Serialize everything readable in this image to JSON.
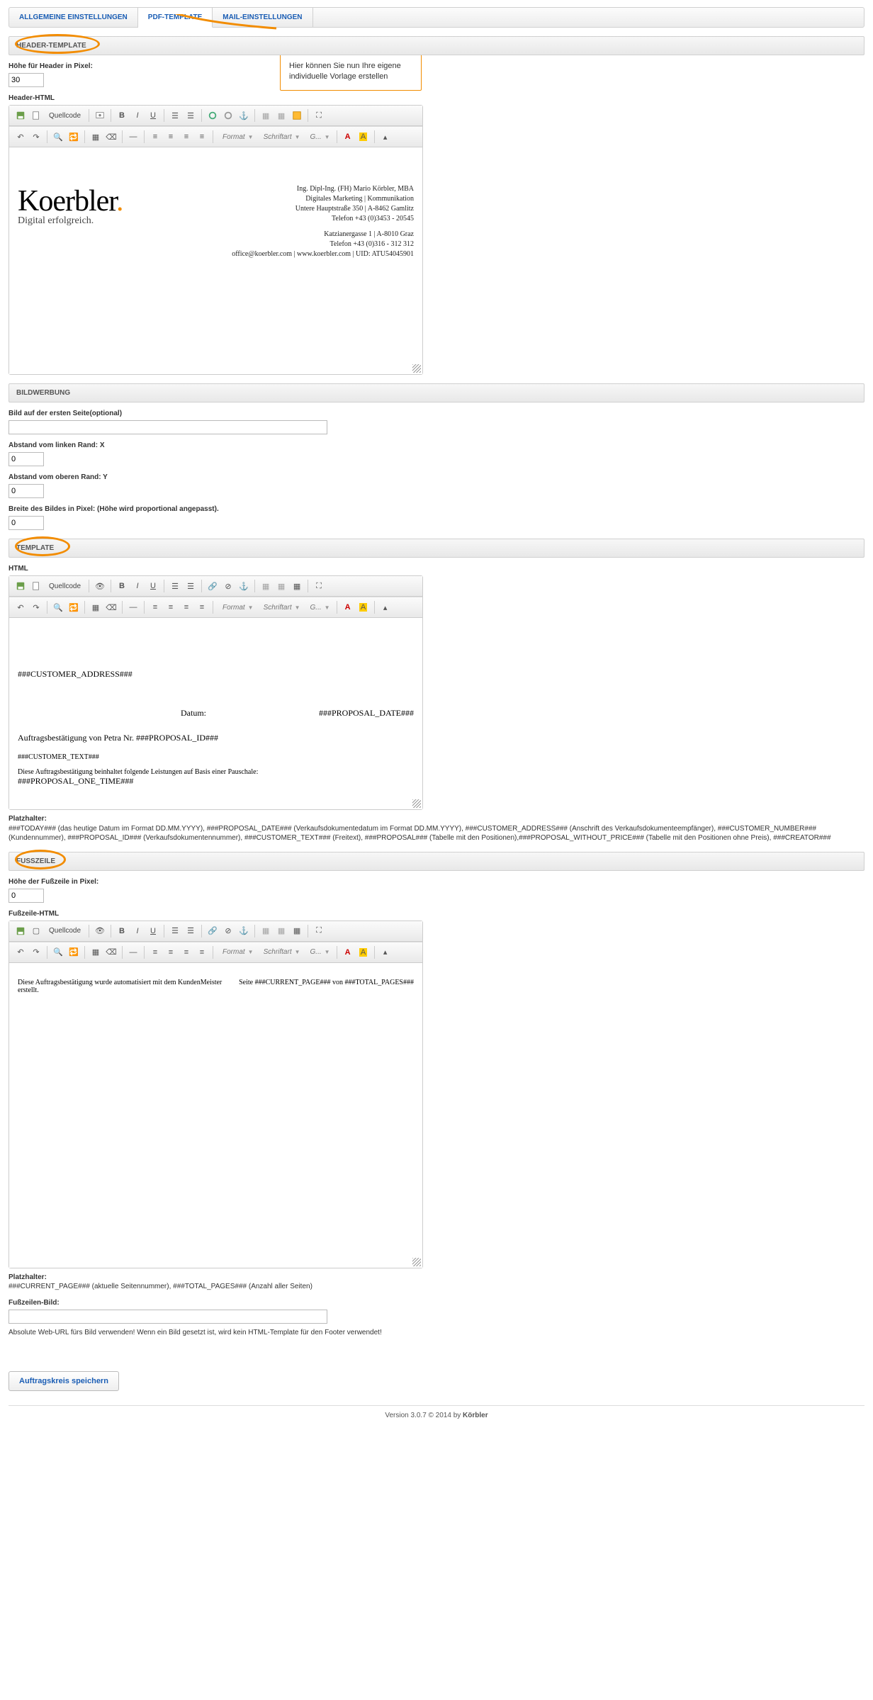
{
  "tabs": {
    "t1": "ALLGEMEINE EINSTELLUNGEN",
    "t2": "PDF-TEMPLATE",
    "t3": "MAIL-EINSTELLUNGEN"
  },
  "callout": "Hier können Sie nun Ihre eigene individuelle Vorlage erstellen",
  "sec_header": "HEADER-TEMPLATE",
  "lbl_header_height": "Höhe für Header in Pixel:",
  "val_header_height": "30",
  "lbl_header_html": "Header-HTML",
  "toolbar": {
    "quellcode": "Quellcode",
    "format": "Format",
    "schriftart": "Schriftart",
    "g": "G..."
  },
  "header_content": {
    "logo1": "Koerbler",
    "logo_dot": ".",
    "logo2": "Digital erfolgreich.",
    "r1": "Ing. Dipl-Ing. (FH) Mario Körbler, MBA",
    "r2": "Digitales Marketing | Kommunikation",
    "r3": "Untere Hauptstraße 350 | A-8462 Gamlitz",
    "r4": "Telefon +43 (0)3453 - 20545",
    "r5": "Katzianergasse 1 | A-8010 Graz",
    "r6": "Telefon +43 (0)316 - 312 312",
    "r7": "office@koerbler.com | www.koerbler.com | UID: ATU54045901"
  },
  "sec_bild": "BILDWERBUNG",
  "lbl_bild_opt": "Bild auf der ersten Seite(optional)",
  "lbl_abstand_x": "Abstand vom linken Rand: X",
  "val_abstand_x": "0",
  "lbl_abstand_y": "Abstand vom oberen Rand: Y",
  "val_abstand_y": "0",
  "lbl_breite": "Breite des Bildes in Pixel: (Höhe wird proportional angepasst).",
  "val_breite": "0",
  "sec_template": "TEMPLATE",
  "lbl_html": "HTML",
  "body_content": {
    "l1": "###CUSTOMER_ADDRESS###",
    "l2a": "Datum:",
    "l2b": "###PROPOSAL_DATE###",
    "l3": "Auftragsbestätigung von Petra Nr. ###PROPOSAL_ID###",
    "l4": "###CUSTOMER_TEXT###",
    "l5": "Diese Auftragsbestätigung beinhaltet folgende Leistungen auf Basis einer Pauschale:",
    "l6": "###PROPOSAL_ONE_TIME###"
  },
  "lbl_platzhalter": "Platzhalter:",
  "platzhalter_body": "###TODAY### (das heutige Datum im Format DD.MM.YYYY), ###PROPOSAL_DATE### (Verkaufsdokumentedatum im Format DD.MM.YYYY), ###CUSTOMER_ADDRESS### (Anschrift des Verkaufsdokumenteempfänger), ###CUSTOMER_NUMBER### (Kundennummer), ###PROPOSAL_ID### (Verkaufsdokumentennummer), ###CUSTOMER_TEXT### (Freitext), ###PROPOSAL### (Tabelle mit den Positionen),###PROPOSAL_WITHOUT_PRICE### (Tabelle mit den Positionen ohne Preis), ###CREATOR###",
  "sec_fuss": "FUSSZEILE",
  "lbl_fuss_height": "Höhe der Fußzeile in Pixel:",
  "val_fuss_height": "0",
  "lbl_fuss_html": "Fußzeile-HTML",
  "foot_content": {
    "l1": "Diese Auftragsbestätigung wurde automatisiert mit dem KundenMeister erstellt.",
    "l2": "Seite ###CURRENT_PAGE### von ###TOTAL_PAGES###"
  },
  "platzhalter_foot": "###CURRENT_PAGE### (aktuelle Seitennummer), ###TOTAL_PAGES### (Anzahl aller Seiten)",
  "lbl_fuss_bild": "Fußzeilen-Bild:",
  "hint_fuss_bild": "Absolute Web-URL fürs Bild verwenden! Wenn ein Bild gesetzt ist, wird kein HTML-Template für den Footer verwendet!",
  "save": "Auftragskreis speichern",
  "footer_version": "Version 3.0.7 © 2014 by ",
  "footer_brand": "Körbler"
}
